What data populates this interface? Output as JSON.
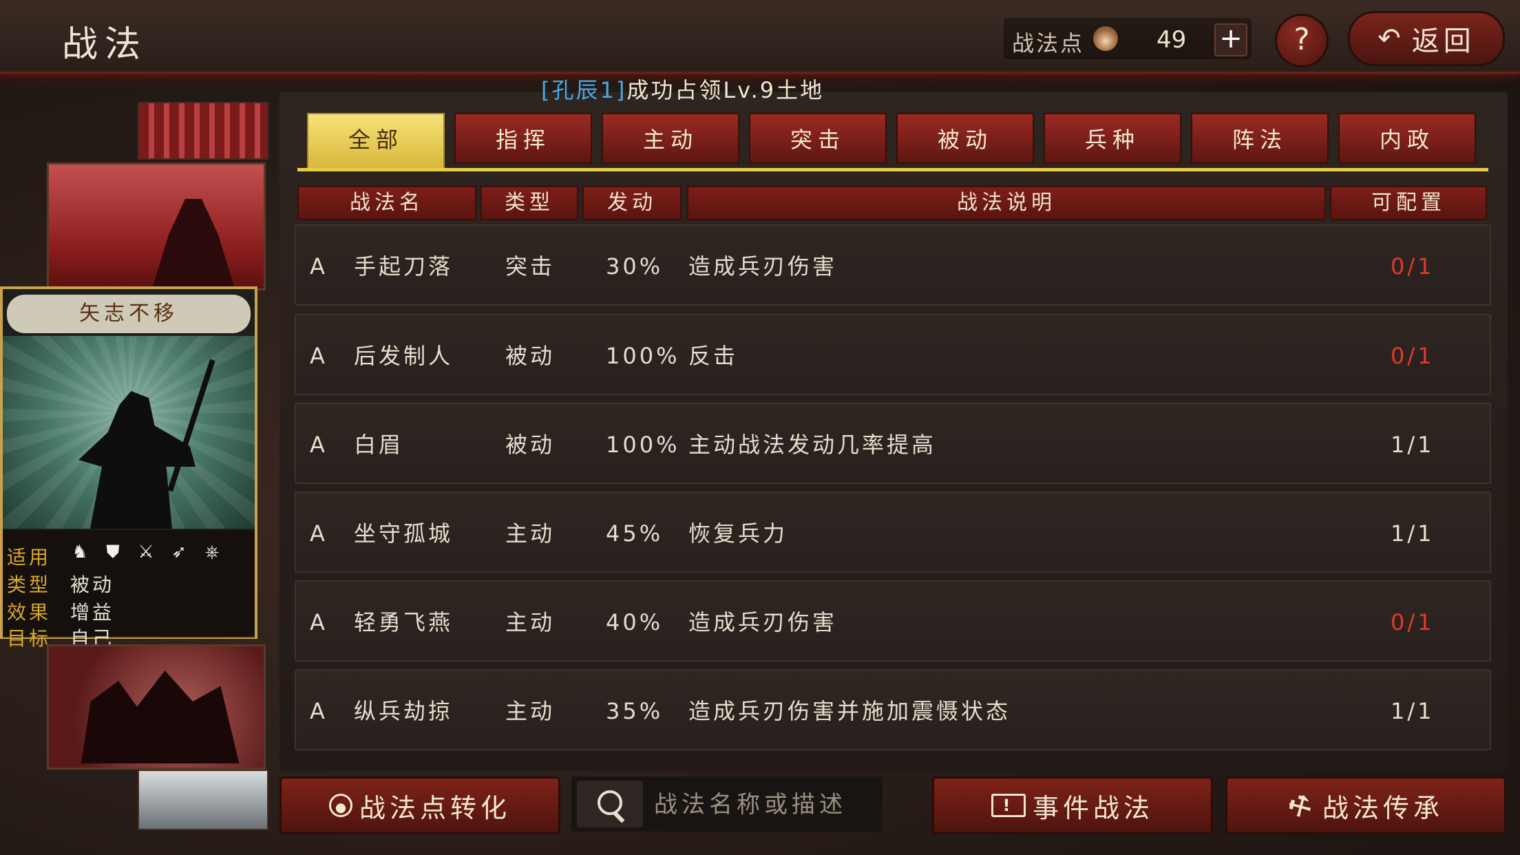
{
  "header": {
    "title": "战法",
    "points_label": "战法点",
    "points_value": "49",
    "plus_label": "+",
    "help_label": "?",
    "back_label": "返回"
  },
  "notice": {
    "who": "[孔辰1]",
    "text": "成功占领Lv.9土地"
  },
  "tabs": [
    {
      "label": "全部",
      "active": true
    },
    {
      "label": "指挥"
    },
    {
      "label": "主动"
    },
    {
      "label": "突击"
    },
    {
      "label": "被动"
    },
    {
      "label": "兵种"
    },
    {
      "label": "阵法"
    },
    {
      "label": "内政"
    }
  ],
  "columns": {
    "name": "战法名",
    "type": "类型",
    "rate": "发动",
    "desc": "战法说明",
    "count": "可配置"
  },
  "rows": [
    {
      "grade": "A",
      "name": "手起刀落",
      "type": "突击",
      "rate": "30%",
      "desc": "造成兵刃伤害",
      "count": "0/1",
      "count_red": true
    },
    {
      "grade": "A",
      "name": "后发制人",
      "type": "被动",
      "rate": "100%",
      "desc": "反击",
      "count": "0/1",
      "count_red": true
    },
    {
      "grade": "A",
      "name": "白眉",
      "type": "被动",
      "rate": "100%",
      "desc": "主动战法发动几率提高",
      "count": "1/1",
      "count_red": false
    },
    {
      "grade": "A",
      "name": "坐守孤城",
      "type": "主动",
      "rate": "45%",
      "desc": "恢复兵力",
      "count": "1/1",
      "count_red": false
    },
    {
      "grade": "A",
      "name": "轻勇飞燕",
      "type": "主动",
      "rate": "40%",
      "desc": "造成兵刃伤害",
      "count": "0/1",
      "count_red": true
    },
    {
      "grade": "A",
      "name": "纵兵劫掠",
      "type": "主动",
      "rate": "35%",
      "desc": "造成兵刃伤害并施加震慑状态",
      "count": "1/1",
      "count_red": false
    }
  ],
  "selected_card": {
    "name": "矢志不移",
    "applies_key": "适用",
    "type_key": "类型",
    "type_val": "被动",
    "effect_key": "效果",
    "effect_val": "增益",
    "target_key": "目标",
    "target_val": "自己",
    "unit_icons": [
      "cavalry-icon",
      "shield-icon",
      "crossed-swords-icon",
      "spear-icon",
      "wheel-icon"
    ]
  },
  "bottom": {
    "convert_label": "战法点转化",
    "search_placeholder": "战法名称或描述",
    "event_label": "事件战法",
    "inherit_label": "战法传承"
  },
  "colors": {
    "accent_gold": "#e8cc48",
    "tab_red": "#9a2a22",
    "count_red": "#e03a2a",
    "notice_blue": "#4aa8e8"
  }
}
